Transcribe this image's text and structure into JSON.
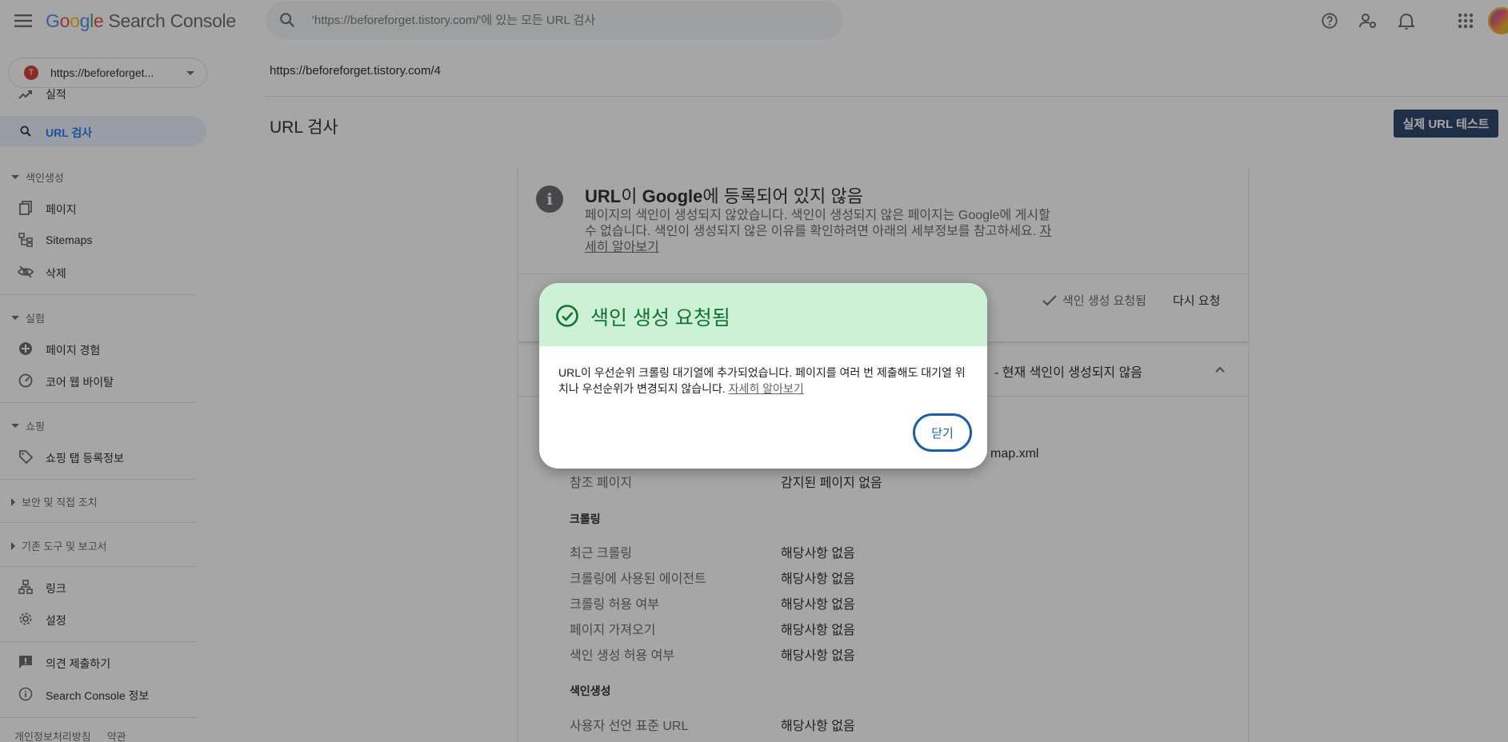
{
  "app": {
    "product_name": "Search Console",
    "logo_letters": [
      "G",
      "o",
      "o",
      "g",
      "l",
      "e"
    ]
  },
  "search": {
    "placeholder": "'https://beforeforget.tistory.com/'에 있는 모든 URL 검사"
  },
  "property": {
    "label": "https://beforeforget..."
  },
  "sidebar": {
    "items": {
      "performance": "실적",
      "url_inspection": "URL 검사",
      "pages": "페이지",
      "sitemaps": "Sitemaps",
      "removals": "삭제",
      "page_experience": "페이지 경험",
      "core_web_vitals": "코어 웹 바이탈",
      "shopping_tab": "쇼핑 탭 등록정보",
      "links": "링크",
      "settings": "설정",
      "feedback": "의견 제출하기",
      "about": "Search Console 정보"
    },
    "sections": {
      "indexing": "색인생성",
      "experience": "실험",
      "shopping": "쇼핑",
      "security": "보안 및 직접 조치",
      "legacy": "기존 도구 및 보고서"
    },
    "footer": {
      "privacy": "개인정보처리방침",
      "terms": "약관"
    }
  },
  "main": {
    "inspected_url": "https://beforeforget.tistory.com/4",
    "page_title": "URL 검사",
    "live_test_button": "실제 URL 테스트",
    "status_card": {
      "title_prefix": "URL",
      "title_mid": "이 ",
      "title_google": "Google",
      "title_suffix": "에 등록되어 있지 않음",
      "description": "페이지의 색인이 생성되지 않았습니다. 색인이 생성되지 않은 페이지는 Google에 게시할 수 없습니다. 색인이 생성되지 않은 이유를 확인하려면 아래의 세부정보를 참고하세요.",
      "learn_more": "자세히 알아보기",
      "request_status": "색인 생성 요청됨",
      "re_request": "다시 요청"
    },
    "details_card": {
      "header": "- 현재 색인이 생성되지 않음",
      "sitemap_fragment": "map.xml",
      "referring_page_label": "참조 페이지",
      "referring_page_value": "감지된 페이지 없음",
      "crawl_section": "크롤링",
      "crawl_rows": [
        {
          "label": "최근 크롤링",
          "value": "해당사항 없음"
        },
        {
          "label": "크롤링에 사용된 에이전트",
          "value": "해당사항 없음"
        },
        {
          "label": "크롤링 허용 여부",
          "value": "해당사항 없음"
        },
        {
          "label": "페이지 가져오기",
          "value": "해당사항 없음"
        },
        {
          "label": "색인 생성 허용 여부",
          "value": "해당사항 없음"
        }
      ],
      "indexing_section": "색인생성",
      "canonical_label": "사용자 선언 표준 URL",
      "canonical_value": "해당사항 없음"
    }
  },
  "dialog": {
    "title": "색인 생성 요청됨",
    "body": "URL이 우선순위 크롤링 대기열에 추가되었습니다. 페이지를 여러 번 제출해도 대기열 위치나 우선순위가 변경되지 않습니다.",
    "learn_more": "자세히 알아보기",
    "close_button": "닫기"
  },
  "colors": {
    "accent": "#1a73e8",
    "dialog_header": "#cdf1d7",
    "success": "#137333",
    "live_test_bg": "#1e3a5f"
  }
}
